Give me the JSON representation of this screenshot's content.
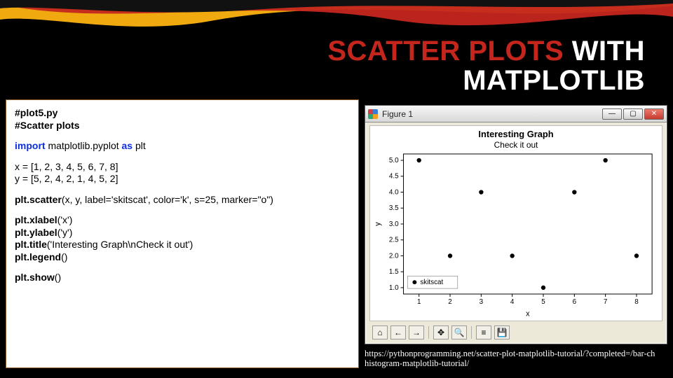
{
  "slide": {
    "title_accent": "SCATTER PLOTS",
    "title_plain": " WITH MATPLOTLIB"
  },
  "code": {
    "comment1": "#plot5.py",
    "comment2": "#Scatter plots",
    "import_kw": "import",
    "import_mod": " matplotlib.pyplot ",
    "import_as": "as",
    "import_alias": " plt",
    "assign_x": "x = [1, 2, 3, 4, 5, 6, 7, 8]",
    "assign_y": "y = [5, 2, 4, 2, 1, 4, 5, 2]",
    "scatter_call": "plt.scatter",
    "scatter_args": "(x, y, label='skitscat', color='k', s=25, marker=\"o\")",
    "xlabel_call": "plt.xlabel",
    "xlabel_args": "('x')",
    "ylabel_call": "plt.ylabel",
    "ylabel_args": "('y')",
    "title_call": "plt.title",
    "title_args": "('Interesting Graph\\nCheck it out')",
    "legend_call": "plt.legend",
    "legend_args": "()",
    "show_call": "plt.show",
    "show_args": "()"
  },
  "figure_window": {
    "title": "Figure 1",
    "minimize": "—",
    "maximize": "▢",
    "close": "✕",
    "toolbar_icons": {
      "home": "⌂",
      "back": "←",
      "forward": "→",
      "pan": "✥",
      "zoom": "🔍",
      "subplots": "≡",
      "save": "💾"
    }
  },
  "chart_data": {
    "type": "scatter",
    "title": "Interesting Graph",
    "subtitle": "Check it out",
    "xlabel": "x",
    "ylabel": "y",
    "x": [
      1,
      2,
      3,
      4,
      5,
      6,
      7,
      8
    ],
    "y": [
      5,
      2,
      4,
      2,
      1,
      4,
      5,
      2
    ],
    "x_ticks": [
      1,
      2,
      3,
      4,
      5,
      6,
      7,
      8
    ],
    "y_ticks": [
      1.0,
      1.5,
      2.0,
      2.5,
      3.0,
      3.5,
      4.0,
      4.5,
      5.0
    ],
    "xlim": [
      0.5,
      8.5
    ],
    "ylim": [
      0.8,
      5.2
    ],
    "legend_label": "skitscat",
    "marker_color": "#000000",
    "marker_size": 3.2
  },
  "citation": {
    "line1": "https://pythonprogramming.net/scatter-plot-matplotlib-tutorial/?completed=/bar-ch",
    "line2": "histogram-matplotlib-tutorial/"
  }
}
